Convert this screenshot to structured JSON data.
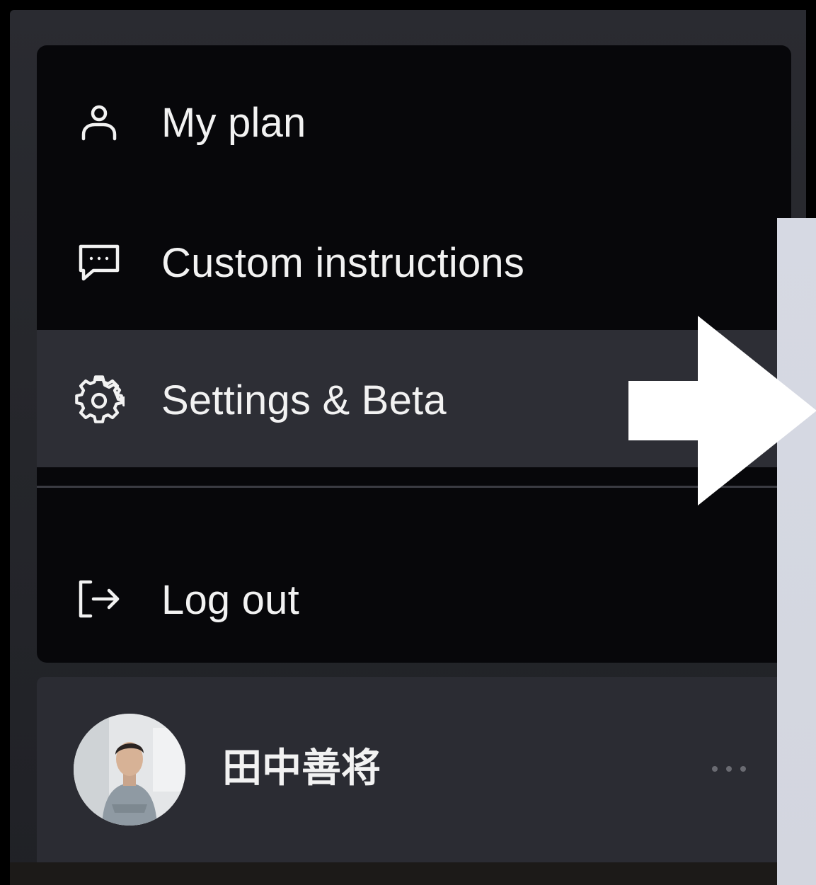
{
  "menu": {
    "items": [
      {
        "label": "My plan",
        "icon": "user-icon"
      },
      {
        "label": "Custom instructions",
        "icon": "chat-bubble-icon"
      },
      {
        "label": "Settings & Beta",
        "icon": "gear-icon",
        "highlighted": true
      },
      {
        "label": "Log out",
        "icon": "logout-icon"
      }
    ]
  },
  "user": {
    "name": "田中善将",
    "avatar": "avatar",
    "more_icon": "ellipsis-icon"
  },
  "annotation": {
    "arrow_icon": "arrow-right-icon",
    "arrow_color": "#ffffff"
  },
  "colors": {
    "menu_bg": "#07070a",
    "highlight_bg": "#2d2e35",
    "text": "#f2f2f2"
  }
}
